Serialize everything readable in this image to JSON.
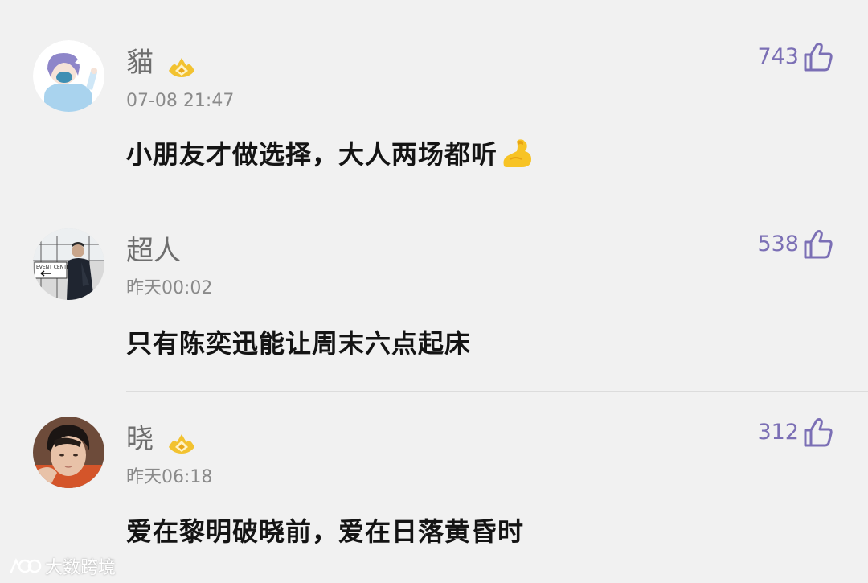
{
  "comments": [
    {
      "username": "貓",
      "timestamp": "07-08 21:47",
      "content": "小朋友才做选择，大人两场都听",
      "likes": "743",
      "has_badge": true
    },
    {
      "username": "超人",
      "timestamp": "昨天00:02",
      "content": "只有陈奕迅能让周末六点起床",
      "likes": "538",
      "has_badge": false
    },
    {
      "username": "晓",
      "timestamp": "昨天06:18",
      "content": "爱在黎明破晓前，爱在日落黄昏时",
      "likes": "312",
      "has_badge": true
    }
  ],
  "avatar_sign_text": "EVENT CENTER",
  "watermark": {
    "text": "大数跨境"
  },
  "colors": {
    "background": "#f1f1f1",
    "accent": "#7b6fb5",
    "badge": "#f2c230",
    "username": "#6e6e6e",
    "timestamp": "#8a8a8a",
    "content": "#141414"
  },
  "icons": {
    "like": "thumbs-up-icon",
    "badge": "crown-badge-icon",
    "emoji": "flexed-biceps-emoji"
  }
}
